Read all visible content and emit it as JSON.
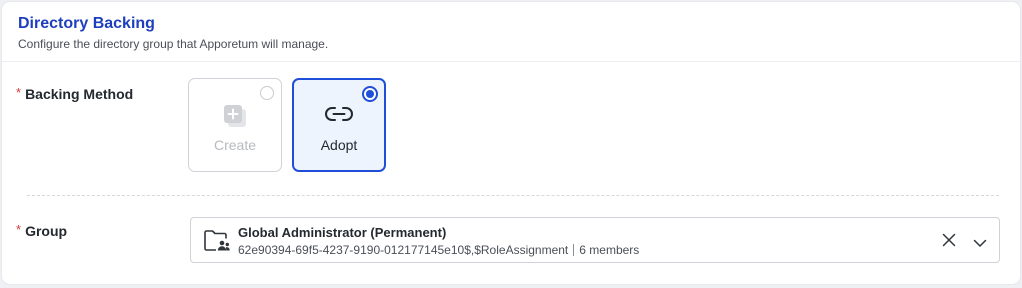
{
  "header": {
    "title": "Directory Backing",
    "subtitle": "Configure the directory group that Apporetum will manage."
  },
  "backing_method": {
    "required_mark": "*",
    "label": "Backing Method",
    "options": [
      {
        "label": "Create",
        "icon": "add-square-icon",
        "state": "disabled"
      },
      {
        "label": "Adopt",
        "icon": "link-icon",
        "state": "selected"
      }
    ]
  },
  "group": {
    "required_mark": "*",
    "label": "Group",
    "selected": {
      "icon": "folder-group-icon",
      "name": "Global Administrator (Permanent)",
      "id": "62e90394-69f5-4237-9190-012177145e10$,$RoleAssignment",
      "members": "6 members"
    }
  },
  "colors": {
    "accent": "#1f4fd8",
    "title": "#1d3fbf",
    "required": "#d63a3a"
  }
}
